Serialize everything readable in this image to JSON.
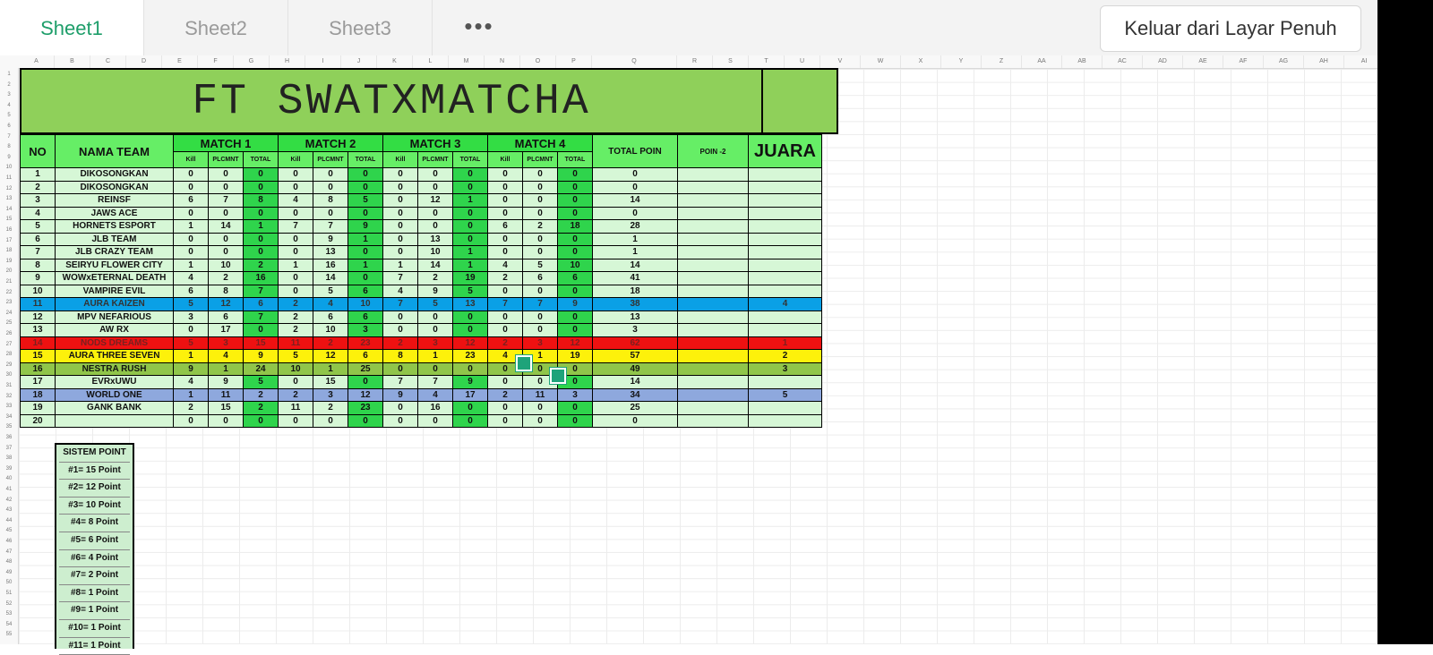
{
  "tabs": [
    {
      "label": "Sheet1",
      "active": true
    },
    {
      "label": "Sheet2",
      "active": false
    },
    {
      "label": "Sheet3",
      "active": false
    }
  ],
  "more_label": "•••",
  "exit_button": "Keluar dari Layar Penuh",
  "columns": [
    "A",
    "B",
    "C",
    "D",
    "E",
    "F",
    "G",
    "H",
    "I",
    "J",
    "K",
    "L",
    "M",
    "N",
    "O",
    "P",
    "Q",
    "R",
    "S",
    "T",
    "U",
    "V",
    "W",
    "X",
    "Y",
    "Z",
    "AA",
    "AB",
    "AC",
    "AD",
    "AE",
    "AF",
    "AG",
    "AH",
    "AI"
  ],
  "title": "FT SWATXMATCHA",
  "headers": {
    "no": "NO",
    "team": "NAMA TEAM",
    "matches": [
      "MATCH 1",
      "MATCH 2",
      "MATCH 3",
      "MATCH 4"
    ],
    "sub": [
      "Kill",
      "PLCMNT",
      "TOTAL"
    ],
    "total": "TOTAL POIN",
    "poin2": "POIN -2",
    "juara": "JUARA"
  },
  "teams": [
    {
      "no": "1",
      "name": "DIKOSONGKAN",
      "m": [
        [
          "0",
          "0",
          "0"
        ],
        [
          "0",
          "0",
          "0"
        ],
        [
          "0",
          "0",
          "0"
        ],
        [
          "0",
          "0",
          "0"
        ]
      ],
      "total": "0",
      "juara": "",
      "hl": ""
    },
    {
      "no": "2",
      "name": "DIKOSONGKAN",
      "m": [
        [
          "0",
          "0",
          "0"
        ],
        [
          "0",
          "0",
          "0"
        ],
        [
          "0",
          "0",
          "0"
        ],
        [
          "0",
          "0",
          "0"
        ]
      ],
      "total": "0",
      "juara": "",
      "hl": ""
    },
    {
      "no": "3",
      "name": "REINSF",
      "m": [
        [
          "6",
          "7",
          "8"
        ],
        [
          "4",
          "8",
          "5"
        ],
        [
          "0",
          "12",
          "1"
        ],
        [
          "0",
          "0",
          "0"
        ]
      ],
      "total": "14",
      "juara": "",
      "hl": ""
    },
    {
      "no": "4",
      "name": "JAWS ACE",
      "m": [
        [
          "0",
          "0",
          "0"
        ],
        [
          "0",
          "0",
          "0"
        ],
        [
          "0",
          "0",
          "0"
        ],
        [
          "0",
          "0",
          "0"
        ]
      ],
      "total": "0",
      "juara": "",
      "hl": ""
    },
    {
      "no": "5",
      "name": "HORNETS ESPORT",
      "m": [
        [
          "1",
          "14",
          "1"
        ],
        [
          "7",
          "7",
          "9"
        ],
        [
          "0",
          "0",
          "0"
        ],
        [
          "6",
          "2",
          "18"
        ]
      ],
      "total": "28",
      "juara": "",
      "hl": ""
    },
    {
      "no": "6",
      "name": "JLB TEAM",
      "m": [
        [
          "0",
          "0",
          "0"
        ],
        [
          "0",
          "9",
          "1"
        ],
        [
          "0",
          "13",
          "0"
        ],
        [
          "0",
          "0",
          "0"
        ]
      ],
      "total": "1",
      "juara": "",
      "hl": ""
    },
    {
      "no": "7",
      "name": "JLB CRAZY TEAM",
      "m": [
        [
          "0",
          "0",
          "0"
        ],
        [
          "0",
          "13",
          "0"
        ],
        [
          "0",
          "10",
          "1"
        ],
        [
          "0",
          "0",
          "0"
        ]
      ],
      "total": "1",
      "juara": "",
      "hl": ""
    },
    {
      "no": "8",
      "name": "SEIRYU FLOWER CITY",
      "m": [
        [
          "1",
          "10",
          "2"
        ],
        [
          "1",
          "16",
          "1"
        ],
        [
          "1",
          "14",
          "1"
        ],
        [
          "4",
          "5",
          "10"
        ]
      ],
      "total": "14",
      "juara": "",
      "hl": ""
    },
    {
      "no": "9",
      "name": "WOWxETERNAL DEATH",
      "m": [
        [
          "4",
          "2",
          "16"
        ],
        [
          "0",
          "14",
          "0"
        ],
        [
          "7",
          "2",
          "19"
        ],
        [
          "2",
          "6",
          "6"
        ]
      ],
      "total": "41",
      "juara": "",
      "hl": ""
    },
    {
      "no": "10",
      "name": "VAMPIRE EVIL",
      "m": [
        [
          "6",
          "8",
          "7"
        ],
        [
          "0",
          "5",
          "6"
        ],
        [
          "4",
          "9",
          "5"
        ],
        [
          "0",
          "0",
          "0"
        ]
      ],
      "total": "18",
      "juara": "",
      "hl": ""
    },
    {
      "no": "11",
      "name": "AURA KAIZEN",
      "m": [
        [
          "5",
          "12",
          "6"
        ],
        [
          "2",
          "4",
          "10"
        ],
        [
          "7",
          "5",
          "13"
        ],
        [
          "7",
          "7",
          "9"
        ]
      ],
      "total": "38",
      "juara": "4",
      "hl": "blue"
    },
    {
      "no": "12",
      "name": "MPV NEFARIOUS",
      "m": [
        [
          "3",
          "6",
          "7"
        ],
        [
          "2",
          "6",
          "6"
        ],
        [
          "0",
          "0",
          "0"
        ],
        [
          "0",
          "0",
          "0"
        ]
      ],
      "total": "13",
      "juara": "",
      "hl": ""
    },
    {
      "no": "13",
      "name": "AW RX",
      "m": [
        [
          "0",
          "17",
          "0"
        ],
        [
          "2",
          "10",
          "3"
        ],
        [
          "0",
          "0",
          "0"
        ],
        [
          "0",
          "0",
          "0"
        ]
      ],
      "total": "3",
      "juara": "",
      "hl": ""
    },
    {
      "no": "14",
      "name": "NODS DREAMS",
      "m": [
        [
          "5",
          "3",
          "15"
        ],
        [
          "11",
          "2",
          "23"
        ],
        [
          "2",
          "3",
          "12"
        ],
        [
          "2",
          "3",
          "12"
        ]
      ],
      "total": "62",
      "juara": "1",
      "hl": "red"
    },
    {
      "no": "15",
      "name": "AURA THREE SEVEN",
      "m": [
        [
          "1",
          "4",
          "9"
        ],
        [
          "5",
          "12",
          "6"
        ],
        [
          "8",
          "1",
          "23"
        ],
        [
          "4",
          "1",
          "19"
        ]
      ],
      "total": "57",
      "juara": "2",
      "hl": "yellow"
    },
    {
      "no": "16",
      "name": "NESTRA RUSH",
      "m": [
        [
          "9",
          "1",
          "24"
        ],
        [
          "10",
          "1",
          "25"
        ],
        [
          "0",
          "0",
          "0"
        ],
        [
          "0",
          "0",
          "0"
        ]
      ],
      "total": "49",
      "juara": "3",
      "hl": "green"
    },
    {
      "no": "17",
      "name": "EVRxUWU",
      "m": [
        [
          "4",
          "9",
          "5"
        ],
        [
          "0",
          "15",
          "0"
        ],
        [
          "7",
          "7",
          "9"
        ],
        [
          "0",
          "0",
          "0"
        ]
      ],
      "total": "14",
      "juara": "",
      "hl": ""
    },
    {
      "no": "18",
      "name": "WORLD ONE",
      "m": [
        [
          "1",
          "11",
          "2"
        ],
        [
          "2",
          "3",
          "12"
        ],
        [
          "9",
          "4",
          "17"
        ],
        [
          "2",
          "11",
          "3"
        ]
      ],
      "total": "34",
      "juara": "5",
      "hl": "slate"
    },
    {
      "no": "19",
      "name": "GANK BANK",
      "m": [
        [
          "2",
          "15",
          "2"
        ],
        [
          "11",
          "2",
          "23"
        ],
        [
          "0",
          "16",
          "0"
        ],
        [
          "0",
          "0",
          "0"
        ]
      ],
      "total": "25",
      "juara": "",
      "hl": ""
    },
    {
      "no": "20",
      "name": "",
      "m": [
        [
          "0",
          "0",
          "0"
        ],
        [
          "0",
          "0",
          "0"
        ],
        [
          "0",
          "0",
          "0"
        ],
        [
          "0",
          "0",
          "0"
        ]
      ],
      "total": "0",
      "juara": "",
      "hl": ""
    }
  ],
  "point_system": {
    "title": "SISTEM POINT",
    "items": [
      "#1= 15 Point",
      "#2= 12 Point",
      "#3= 10 Point",
      "#4= 8 Point",
      "#5= 6 Point",
      "#6= 4 Point",
      "#7= 2 Point",
      "#8= 1 Point",
      "#9= 1 Point",
      "#10= 1 Point",
      "#11= 1 Point"
    ]
  },
  "colors": {
    "accent": "#1e9e6a",
    "title_bg": "#8fd05a",
    "header_bg": "#66ee66",
    "total_bg": "#2fd44c",
    "row_bg": "#d6f7d6"
  }
}
